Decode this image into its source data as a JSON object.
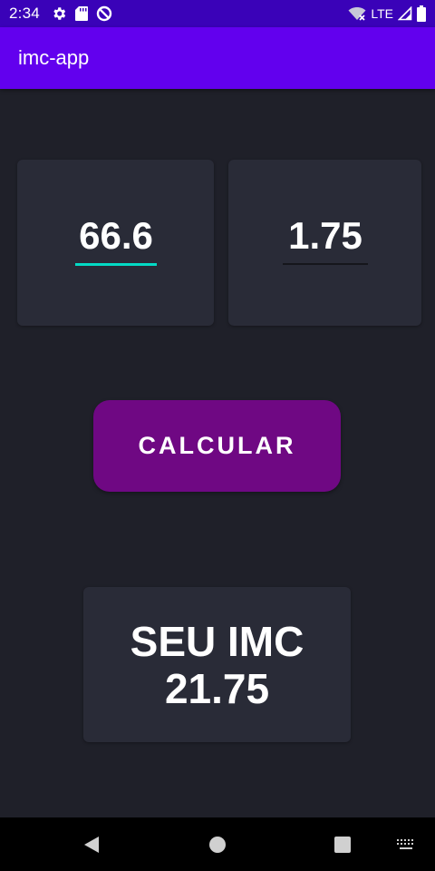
{
  "status_bar": {
    "time": "2:34",
    "network": "LTE",
    "icons": [
      "gear-icon",
      "sd-card-icon",
      "do-not-disturb-icon",
      "wifi-icon",
      "signal-icon",
      "battery-icon"
    ]
  },
  "app_bar": {
    "title": "imc-app"
  },
  "inputs": {
    "weight_value": "66.6",
    "height_value": "1.75"
  },
  "calculate_button": {
    "label": "CALCULAR"
  },
  "result": {
    "label": "SEU IMC",
    "value": "21.75"
  },
  "nav_bar": {
    "icons": [
      "back-icon",
      "home-icon",
      "recents-icon",
      "keyboard-icon"
    ]
  },
  "colors": {
    "status_bar": "#3a02b8",
    "app_bar": "#6200ee",
    "background": "#1f2029",
    "card": "#292b37",
    "button": "#6f0883",
    "input_underline_active": "#03dac5"
  }
}
